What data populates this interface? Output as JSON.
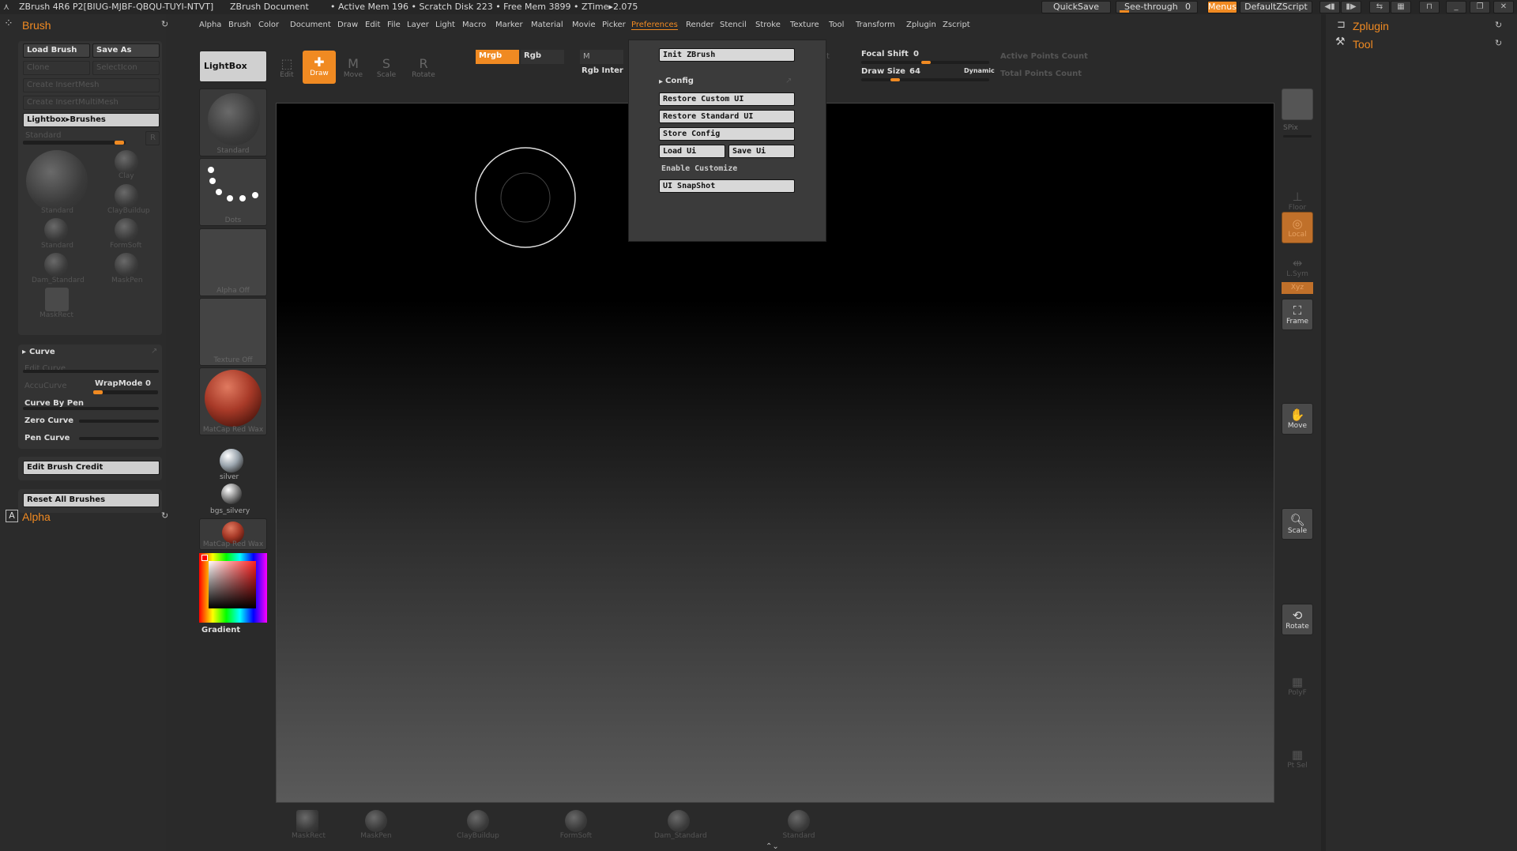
{
  "titlebar": {
    "app": "ZBrush 4R6 P2[BIUG-MJBF-QBQU-TUYI-NTVT]",
    "doc": "ZBrush Document",
    "status": "• Active Mem 196 • Scratch Disk 223 • Free Mem 3899 • ZTime▸2.075",
    "quicksave": "QuickSave",
    "seethrough": "See-through",
    "seethrough_value": "0",
    "menus": "Menus",
    "script": "DefaultZScript"
  },
  "menubar": [
    "Alpha",
    "Brush",
    "Color",
    "Document",
    "Draw",
    "Edit",
    "File",
    "Layer",
    "Light",
    "Macro",
    "Marker",
    "Material",
    "Movie",
    "Picker",
    "Preferences",
    "Render",
    "Stencil",
    "Stroke",
    "Texture",
    "Tool",
    "Transform",
    "Zplugin",
    "Zscript"
  ],
  "menubar_active": "Preferences",
  "brush_panel": {
    "title": "Brush",
    "load_brush": "Load Brush",
    "save_as": "Save As",
    "clone": "Clone",
    "selecticon": "SelectIcon",
    "create_insertmesh": "Create InsertMesh",
    "create_insertmultimesh": "Create InsertMultiMesh",
    "lightbox_brushes": "Lightbox▸Brushes",
    "current_brush": "Standard",
    "r_label": "R",
    "brushes": [
      "Standard",
      "Clay",
      "ClayBuildup",
      "Standard",
      "FormSoft",
      "Dam_Standard",
      "MaskPen",
      "MaskRect"
    ],
    "curve": {
      "title": "Curve",
      "edit_curve": "Edit Curve",
      "accucurve": "AccuCurve",
      "wrapmode": "WrapMode",
      "wrapmode_value": "0",
      "curve_by_pen": "Curve By Pen",
      "zero_curve": "Zero Curve",
      "pen_curve": "Pen Curve"
    },
    "edit_brush_credit": "Edit Brush Credit",
    "reset_all_brushes": "Reset All Brushes"
  },
  "alpha_panel": {
    "title": "Alpha"
  },
  "shelf": {
    "lightbox": "LightBox",
    "brush_tile": "Standard",
    "stroke_tile": "Dots",
    "alpha_tile": "Alpha Off",
    "texture_tile": "Texture Off",
    "material_tile": "MatCap Red Wax",
    "mat1": "silver",
    "mat2": "bgs_silvery",
    "mat3": "MatCap Red Wax",
    "gradient": "Gradient"
  },
  "tools": {
    "edit": "Edit",
    "draw": "Draw",
    "move": "Move",
    "scale": "Scale",
    "rotate": "Rotate"
  },
  "color_row": {
    "mrgb": "Mrgb",
    "rgb": "Rgb",
    "m": "M",
    "rgb_intensity": "Rgb Inter"
  },
  "draw_settings": {
    "focal_shift_label": "Focal Shift",
    "focal_shift": "0",
    "draw_size_label": "Draw Size",
    "draw_size": "64",
    "dynamic": "Dynamic",
    "active_points": "Active Points Count",
    "total_points": "Total Points Count"
  },
  "preferences_menu": {
    "init": "Init ZBrush",
    "config": "Config",
    "restore_custom": "Restore Custom UI",
    "restore_standard": "Restore Standard UI",
    "store_config": "Store Config",
    "load_ui": "Load Ui",
    "save_ui": "Save Ui",
    "enable_customize": "Enable Customize",
    "ui_snapshot": "UI SnapShot"
  },
  "right_rail": {
    "spix": "SPix",
    "floor": "Floor",
    "local": "Local",
    "lsym": "L.Sym",
    "xyz": "Xyz",
    "frame": "Frame",
    "move": "Move",
    "scale": "Scale",
    "rotate": "Rotate",
    "polyf": "PolyF",
    "transp": "Pt Sel"
  },
  "right_panel": {
    "zplugin": "Zplugin",
    "tool": "Tool"
  },
  "bottom_shelf": [
    "MaskRect",
    "MaskPen",
    "ClayBuildup",
    "FormSoft",
    "Dam_Standard",
    "Standard"
  ],
  "colors": {
    "accent": "#f08a22",
    "panel": "#2b2b2b",
    "canvas_top": "#000000"
  }
}
